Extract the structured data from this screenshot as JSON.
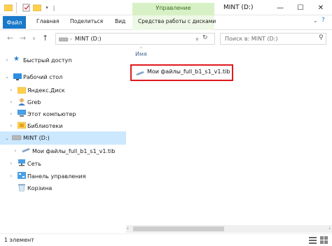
{
  "window": {
    "title": "MINT (D:)",
    "contextual_group": "Управление",
    "controls": {
      "minimize": "—",
      "maximize": "☐",
      "close": "✕"
    }
  },
  "ribbon": {
    "tabs": [
      {
        "label": "Файл"
      },
      {
        "label": "Главная"
      },
      {
        "label": "Поделиться"
      },
      {
        "label": "Вид"
      },
      {
        "label": "Средства работы с дисками"
      }
    ]
  },
  "address": {
    "path": "MINT (D:)",
    "search_placeholder": "Поиск в: MINT (D:)"
  },
  "nav": {
    "items": [
      {
        "label": "Быстрый доступ",
        "icon": "star-icon"
      },
      {
        "label": "Рабочий стол",
        "icon": "desktop-icon"
      },
      {
        "label": "Яндекс.Диск",
        "icon": "yandex-disk-icon"
      },
      {
        "label": "Greb",
        "icon": "user-folder-icon"
      },
      {
        "label": "Этот компьютер",
        "icon": "computer-icon"
      },
      {
        "label": "Библиотеки",
        "icon": "libraries-icon"
      },
      {
        "label": "MINT (D:)",
        "icon": "drive-icon"
      },
      {
        "label": "Мои файлы_full_b1_s1_v1.tib",
        "icon": "tib-file-icon"
      },
      {
        "label": "Сеть",
        "icon": "network-icon"
      },
      {
        "label": "Панель управления",
        "icon": "control-panel-icon"
      },
      {
        "label": "Корзина",
        "icon": "recycle-bin-icon"
      }
    ]
  },
  "content": {
    "column_header": "Имя",
    "files": [
      {
        "name": "Мои файлы_full_b1_s1_v1.tib",
        "icon": "tib-file-icon"
      }
    ]
  },
  "status": {
    "item_count": "1 элемент"
  },
  "colors": {
    "accent": "#1979ca",
    "manage": "#d8f0c6",
    "selected": "#cce8ff",
    "highlight": "#e0191e"
  }
}
